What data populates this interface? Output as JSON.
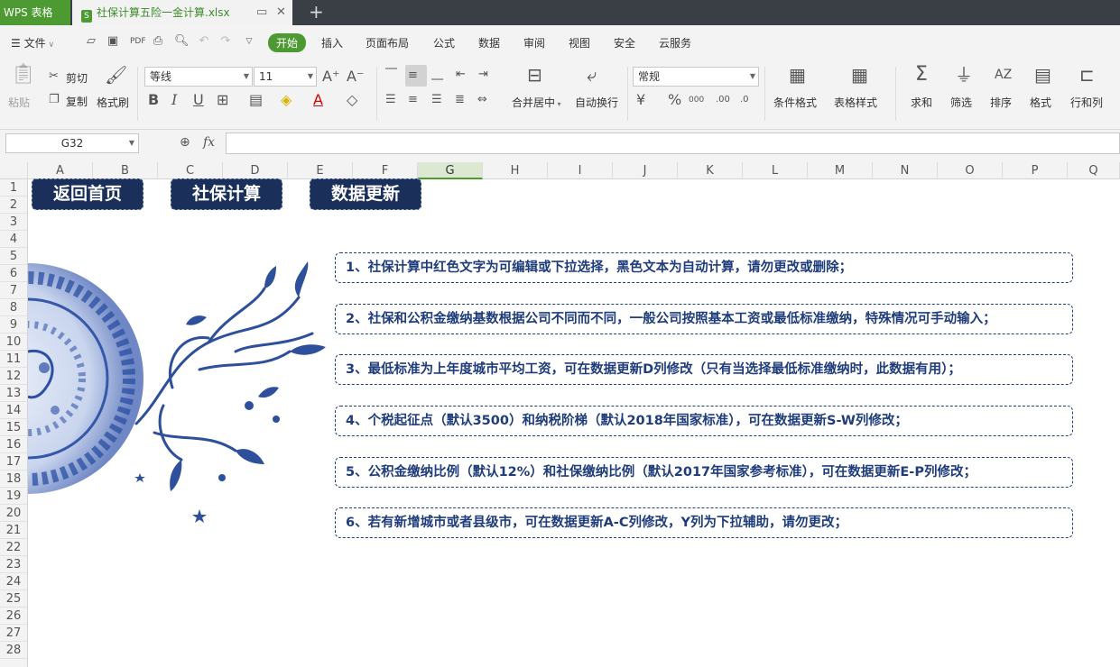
{
  "titlebar": {
    "app_name": "WPS 表格",
    "doc_tab": "社保计算五险一金计算.xlsx",
    "new_tab": "+"
  },
  "menubar": {
    "file_label": "文件",
    "tabs": [
      {
        "label": "开始",
        "active": true
      },
      {
        "label": "插入"
      },
      {
        "label": "页面布局"
      },
      {
        "label": "公式"
      },
      {
        "label": "数据"
      },
      {
        "label": "审阅"
      },
      {
        "label": "视图"
      },
      {
        "label": "安全"
      },
      {
        "label": "云服务"
      }
    ]
  },
  "ribbon": {
    "paste": "粘贴",
    "cut": "剪切",
    "copy": "复制",
    "format_painter": "格式刷",
    "font_name": "等线",
    "font_size": "11",
    "merge_center": "合并居中",
    "wrap_text": "自动换行",
    "number_format": "常规",
    "conditional_format": "条件格式",
    "table_style": "表格样式",
    "sum": "求和",
    "filter": "筛选",
    "sort": "排序",
    "format": "格式",
    "rows_cols": "行和列",
    "thousand_sep": "000",
    "dec_inc": ".00",
    "dec_dec": ".0"
  },
  "formula_bar": {
    "name_box": "G32",
    "fx": "fx",
    "formula": ""
  },
  "columns": [
    "A",
    "B",
    "C",
    "D",
    "E",
    "F",
    "G",
    "H",
    "I",
    "J",
    "K",
    "L",
    "M",
    "N",
    "O",
    "P",
    "Q"
  ],
  "selected_column": "G",
  "rows": [
    "1",
    "2",
    "3",
    "4",
    "5",
    "6",
    "7",
    "8",
    "9",
    "10",
    "11",
    "12",
    "13",
    "14",
    "15",
    "16",
    "17",
    "18",
    "19",
    "20",
    "21",
    "22",
    "23",
    "24",
    "25",
    "26",
    "27",
    "28"
  ],
  "nav_buttons": [
    "返回首页",
    "社保计算",
    "数据更新"
  ],
  "notes": [
    "1、社保计算中红色文字为可编辑或下拉选择，黑色文本为自动计算，请勿更改或删除；",
    "2、社保和公积金缴纳基数根据公司不同而不同，一般公司按照基本工资或最低标准缴纳，特殊情况可手动输入；",
    "3、最低标准为上年度城市平均工资，可在数据更新D列修改（只有当选择最低标准缴纳时，此数据有用）；",
    "4、个税起征点（默认3500）和纳税阶梯（默认2018年国家标准），可在数据更新S-W列修改；",
    "5、公积金缴纳比例（默认12%）和社保缴纳比例（默认2017年国家参考标准），可在数据更新E-P列修改；",
    "6、若有新增城市或者县级市，可在数据更新A-C列修改，Y列为下拉辅助，请勿更改；"
  ],
  "colors": {
    "accent_green": "#4e9a32",
    "navy": "#1a2f5a",
    "note_text": "#1f3d7a"
  }
}
